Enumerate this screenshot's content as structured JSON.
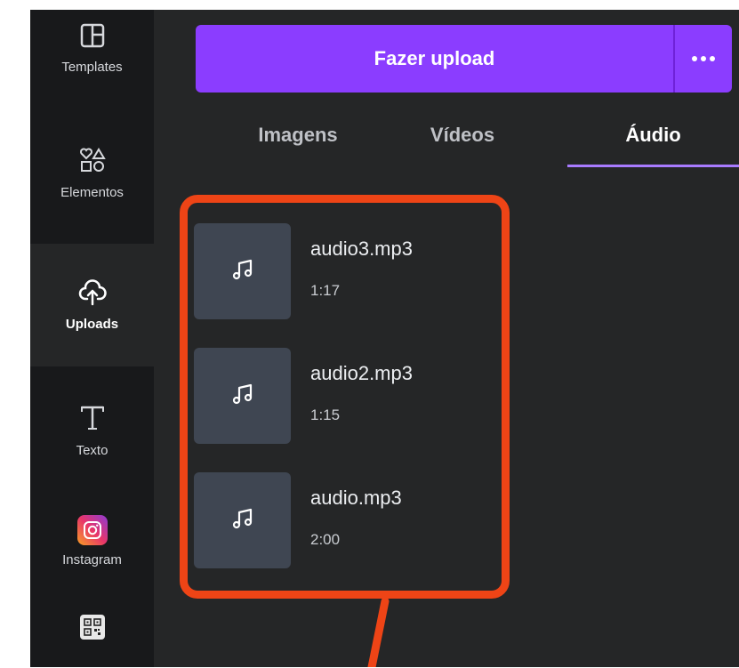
{
  "sidebar": {
    "items": [
      {
        "label": "Templates",
        "icon": "templates-icon"
      },
      {
        "label": "Elementos",
        "icon": "elements-icon"
      },
      {
        "label": "Uploads",
        "icon": "cloud-upload-icon",
        "active": true
      },
      {
        "label": "Texto",
        "icon": "text-icon"
      },
      {
        "label": "Instagram",
        "icon": "instagram-icon"
      },
      {
        "label": "",
        "icon": "qr-code-icon"
      }
    ]
  },
  "upload": {
    "button_label": "Fazer upload",
    "more_icon": "more-horizontal-icon"
  },
  "tabs": [
    {
      "label": "Imagens"
    },
    {
      "label": "Vídeos"
    },
    {
      "label": "Áudio",
      "active": true
    }
  ],
  "audio_files": [
    {
      "name": "audio3.mp3",
      "duration": "1:17"
    },
    {
      "name": "audio2.mp3",
      "duration": "1:15"
    },
    {
      "name": "audio.mp3",
      "duration": "2:00"
    }
  ],
  "colors": {
    "accent": "#8b3dff",
    "annotation": "#ee4416",
    "sidebar_bg": "#18191b",
    "panel_bg": "#252627"
  }
}
